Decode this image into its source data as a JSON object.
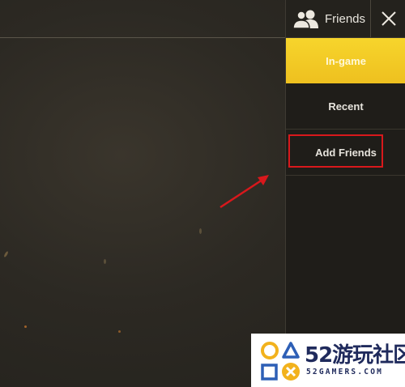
{
  "panel": {
    "title": "Friends",
    "header_icon": "friends-icon",
    "close_icon": "close-icon",
    "tabs": [
      {
        "label": "In-game",
        "active": true
      },
      {
        "label": "Recent",
        "active": false
      },
      {
        "label": "Add Friends",
        "active": false,
        "highlighted": true
      }
    ]
  },
  "annotation": {
    "highlight_color": "#d8181c",
    "arrow_color": "#d8181c"
  },
  "watermark": {
    "brand": "52游玩社区",
    "domain": "52GAMERS.COM"
  },
  "colors": {
    "accent": "#f2c823",
    "background": "#2b2822",
    "panel": "#1f1d19"
  }
}
